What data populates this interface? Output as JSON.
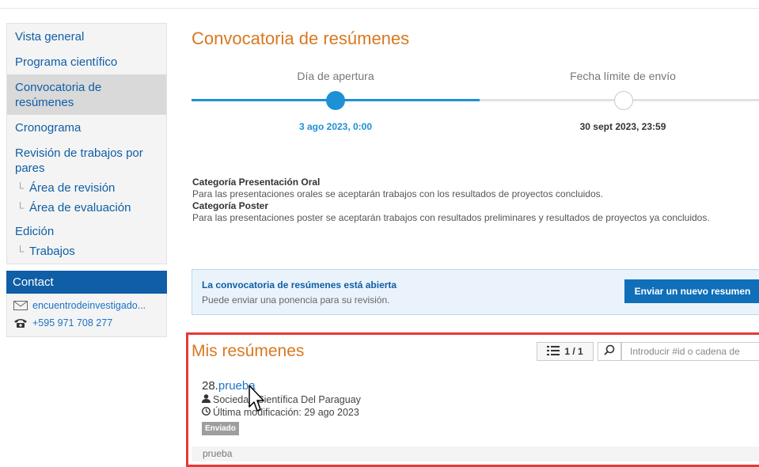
{
  "sidebar": {
    "items": [
      {
        "label": "Vista general"
      },
      {
        "label": "Programa científico"
      },
      {
        "label": "Convocatoria de resúmenes"
      },
      {
        "label": "Cronograma"
      },
      {
        "label": "Revisión de trabajos por pares"
      }
    ],
    "sub_review": [
      {
        "label": "Área de revisión"
      },
      {
        "label": "Área de evaluación"
      }
    ],
    "edicion": "Edición",
    "sub_edicion": [
      {
        "label": "Trabajos"
      }
    ],
    "contact": {
      "title": "Contact",
      "email": "encuentrodeinvestigado...",
      "phone": "+595 971 708 277"
    }
  },
  "main": {
    "title": "Convocatoria de resúmenes",
    "timeline": {
      "start_label": "Día de apertura",
      "start_date": "3 ago 2023, 0:00",
      "end_label": "Fecha límite de envío",
      "end_date": "30 sept 2023, 23:59"
    },
    "description": {
      "cat1_title": "Categoría Presentación Oral",
      "cat1_text": "Para las presentaciones orales se aceptarán trabajos con los resultados de proyectos concluidos.",
      "cat2_title": "Categoría Poster",
      "cat2_text": "Para las presentaciones poster se aceptarán trabajos con resultados preliminares y resultados de proyectos ya concluidos."
    },
    "alert": {
      "title": "La convocatoria de resúmenes está abierta",
      "text": "Puede enviar una ponencia para su revisión.",
      "button": "Enviar un nuevo resumen"
    },
    "my_abstracts": {
      "title": "Mis resúmenes",
      "pager": "1 / 1",
      "search_placeholder": "Introducir #id o cadena de",
      "entries": [
        {
          "id": "28.",
          "title": "prueba",
          "author": "Sociedad Científica Del Paraguay",
          "modified": "Última modificación: 29 ago 2023",
          "status": "Enviado",
          "note": "prueba"
        }
      ]
    }
  },
  "colors": {
    "accent_orange": "#d8781f",
    "link_blue": "#0f5ea6",
    "timeline_blue": "#1e90d6",
    "highlight_red": "#e53935"
  }
}
